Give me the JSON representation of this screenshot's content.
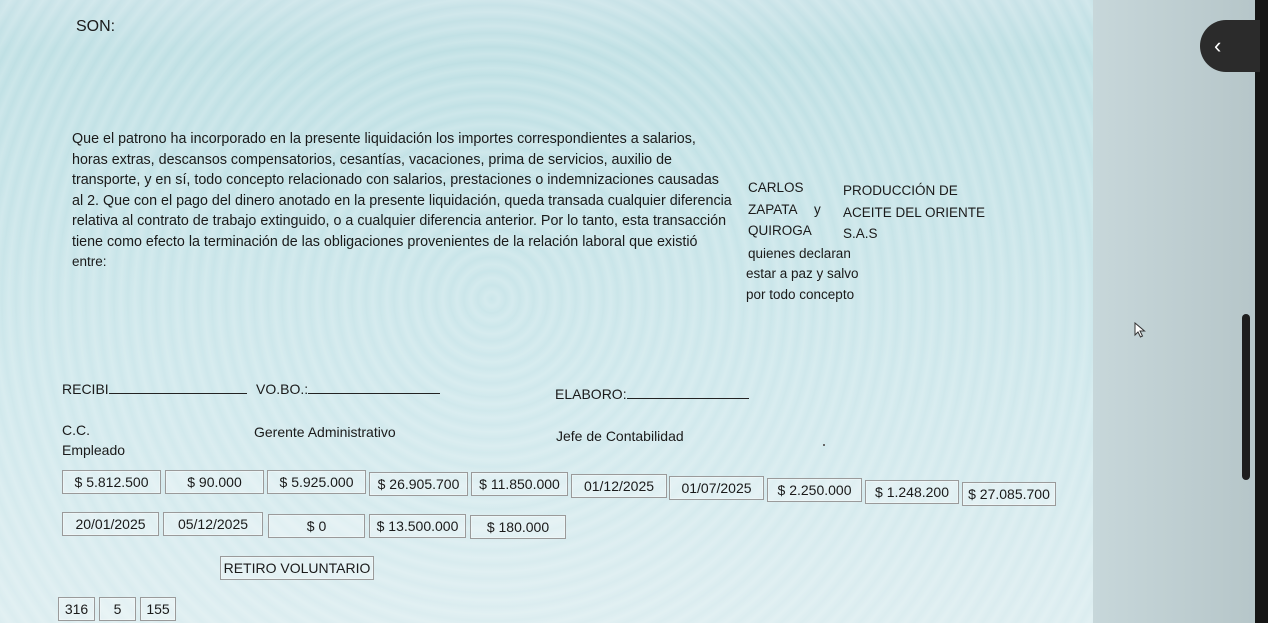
{
  "header": {
    "son_label": "SON:"
  },
  "paragraph_lines": [
    "Que el patrono ha incorporado en la presente liquidación los importes correspondientes a salarios,",
    "horas extras, descansos compensatorios, cesantías, vacaciones, prima de servicios, auxilio de",
    "transporte, y en sí, todo concepto relacionado con salarios, prestaciones o indemnizaciones causadas",
    "al 2. Que con el pago del dinero anotado en  la presente liquidación, queda transada cualquier diferencia",
    "relativa al contrato de trabajo extinguido, o a cualquier diferencia anterior. Por lo tanto, esta transacción",
    "tiene como efecto la terminación de las obligaciones provenientes de la relación laboral que existió",
    "entre:"
  ],
  "employee_name": {
    "line1": "CARLOS",
    "line2": "ZAPATA",
    "connector": "y",
    "line3": "QUIROGA"
  },
  "company_name": {
    "line1": "PRODUCCIÓN DE",
    "line2": "ACEITE DEL ORIENTE",
    "line3": "S.A.S"
  },
  "declaration_lines": [
    "quienes declaran",
    "estar a paz y salvo",
    "por todo concepto"
  ],
  "signatures": {
    "recibi": "RECIBI",
    "vobo": "VO.BO.:",
    "elaboro": "ELABORO:",
    "cc": "C.C.",
    "empleado": "Empleado",
    "gerente": "Gerente Administrativo",
    "jefe": "Jefe de Contabilidad"
  },
  "fields_row1": [
    "$ 5.812.500",
    "$ 90.000",
    "$ 5.925.000",
    "$ 26.905.700",
    "$ 11.850.000",
    "01/12/2025",
    "01/07/2025",
    "$ 2.250.000",
    "$ 1.248.200",
    "$ 27.085.700"
  ],
  "fields_row2": [
    "20/01/2025",
    "05/12/2025",
    "$ 0",
    "$ 13.500.000",
    "$ 180.000"
  ],
  "retiro_field": "RETIRO VOLUNTARIO",
  "fields_row4": [
    "316",
    "5",
    "155"
  ],
  "ui": {
    "collapse_glyph": "‹"
  }
}
